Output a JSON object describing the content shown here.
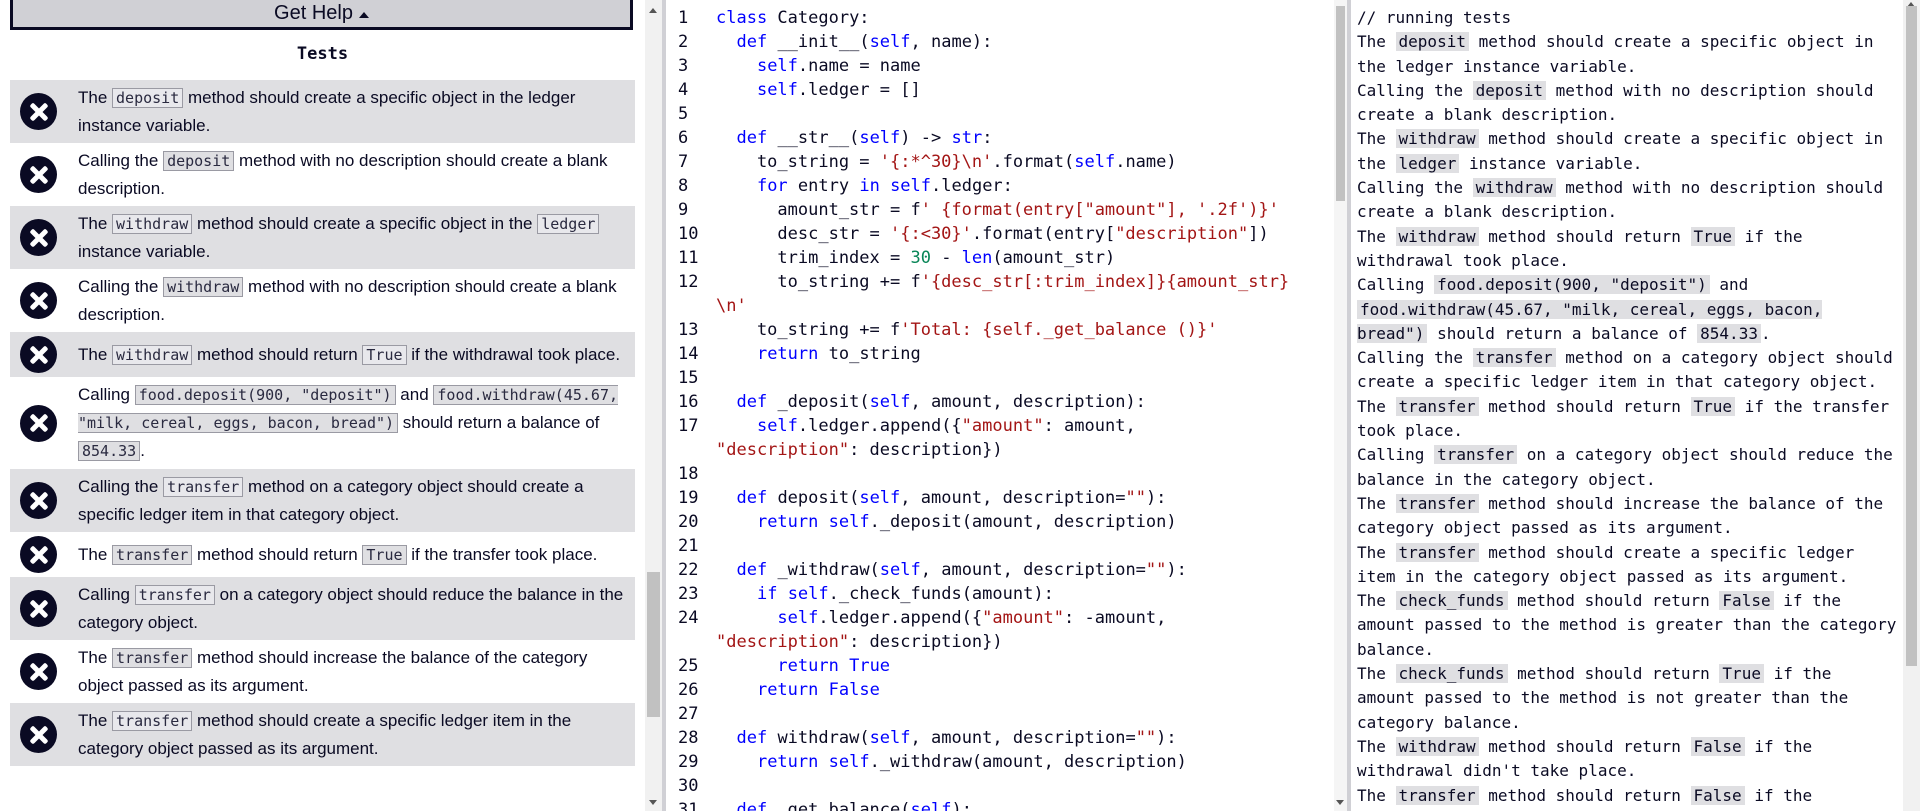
{
  "help_button": {
    "label": "Get Help"
  },
  "tests_heading": "Tests",
  "tests": [
    [
      {
        "t": "The "
      },
      {
        "c": "deposit"
      },
      {
        "t": " method should create a specific object in the ledger instance variable."
      }
    ],
    [
      {
        "t": "Calling the "
      },
      {
        "c": "deposit"
      },
      {
        "t": " method with no description should create a blank description."
      }
    ],
    [
      {
        "t": "The "
      },
      {
        "c": "withdraw"
      },
      {
        "t": " method should create a specific object in the "
      },
      {
        "c": "ledger"
      },
      {
        "t": " instance variable."
      }
    ],
    [
      {
        "t": "Calling the "
      },
      {
        "c": "withdraw"
      },
      {
        "t": " method with no description should create a blank description."
      }
    ],
    [
      {
        "t": "The "
      },
      {
        "c": "withdraw"
      },
      {
        "t": " method should return "
      },
      {
        "c": "True"
      },
      {
        "t": " if the withdrawal took place."
      }
    ],
    [
      {
        "t": "Calling "
      },
      {
        "c": "food.deposit(900, \"deposit\")"
      },
      {
        "t": " and "
      },
      {
        "c": "food.withdraw(45.67, \"milk, cereal, eggs, bacon, bread\")"
      },
      {
        "t": " should return a balance of "
      },
      {
        "c": "854.33"
      },
      {
        "t": "."
      }
    ],
    [
      {
        "t": "Calling the "
      },
      {
        "c": "transfer"
      },
      {
        "t": " method on a category object should create a specific ledger item in that category object."
      }
    ],
    [
      {
        "t": "The "
      },
      {
        "c": "transfer"
      },
      {
        "t": " method should return "
      },
      {
        "c": "True"
      },
      {
        "t": " if the transfer took place."
      }
    ],
    [
      {
        "t": "Calling "
      },
      {
        "c": "transfer"
      },
      {
        "t": " on a category object should reduce the balance in the category object."
      }
    ],
    [
      {
        "t": "The "
      },
      {
        "c": "transfer"
      },
      {
        "t": " method should increase the balance of the category object passed as its argument."
      }
    ],
    [
      {
        "t": "The "
      },
      {
        "c": "transfer"
      },
      {
        "t": " method should create a specific ledger item in the category object passed as its argument."
      }
    ]
  ],
  "code_lines": [
    {
      "n": "1",
      "s": [
        [
          "kw",
          "class"
        ],
        [
          "op",
          " Category:"
        ]
      ]
    },
    {
      "n": "2",
      "s": [
        [
          "op",
          "  "
        ],
        [
          "kw",
          "def"
        ],
        [
          "op",
          " __init__("
        ],
        [
          "slf",
          "self"
        ],
        [
          "op",
          ", name):"
        ]
      ]
    },
    {
      "n": "3",
      "s": [
        [
          "op",
          "    "
        ],
        [
          "slf",
          "self"
        ],
        [
          "op",
          ".name = name"
        ]
      ]
    },
    {
      "n": "4",
      "s": [
        [
          "op",
          "    "
        ],
        [
          "slf",
          "self"
        ],
        [
          "op",
          ".ledger = []"
        ]
      ]
    },
    {
      "n": "5",
      "s": []
    },
    {
      "n": "6",
      "s": [
        [
          "op",
          "  "
        ],
        [
          "kw",
          "def"
        ],
        [
          "op",
          " __str__("
        ],
        [
          "slf",
          "self"
        ],
        [
          "op",
          ") -> "
        ],
        [
          "kw",
          "str"
        ],
        [
          "op",
          ":"
        ]
      ]
    },
    {
      "n": "7",
      "s": [
        [
          "op",
          "    to_string = "
        ],
        [
          "str",
          "'{:*^30}\\n'"
        ],
        [
          "op",
          ".format("
        ],
        [
          "slf",
          "self"
        ],
        [
          "op",
          ".name)"
        ]
      ]
    },
    {
      "n": "8",
      "s": [
        [
          "op",
          "    "
        ],
        [
          "kw",
          "for"
        ],
        [
          "op",
          " entry "
        ],
        [
          "kw",
          "in"
        ],
        [
          "op",
          " "
        ],
        [
          "slf",
          "self"
        ],
        [
          "op",
          ".ledger:"
        ]
      ]
    },
    {
      "n": "9",
      "s": [
        [
          "op",
          "      amount_str = f"
        ],
        [
          "str",
          "' {format(entry[\"amount\"], '.2f')}'"
        ]
      ]
    },
    {
      "n": "10",
      "s": [
        [
          "op",
          "      desc_str = "
        ],
        [
          "str",
          "'{:<30}'"
        ],
        [
          "op",
          ".format(entry["
        ],
        [
          "str",
          "\"description\""
        ],
        [
          "op",
          "])"
        ]
      ]
    },
    {
      "n": "11",
      "s": [
        [
          "op",
          "      trim_index = "
        ],
        [
          "num",
          "30"
        ],
        [
          "op",
          " - "
        ],
        [
          "kw",
          "len"
        ],
        [
          "op",
          "(amount_str)"
        ]
      ]
    },
    {
      "n": "12",
      "s": [
        [
          "op",
          "      to_string += f"
        ],
        [
          "str",
          "'{desc_str[:trim_index]}{amount_str}"
        ]
      ]
    },
    {
      "n": "",
      "s": [
        [
          "str",
          "\\n'"
        ]
      ]
    },
    {
      "n": "13",
      "s": [
        [
          "op",
          "    to_string += f"
        ],
        [
          "str",
          "'Total: {self._get_balance ()}'"
        ]
      ]
    },
    {
      "n": "14",
      "s": [
        [
          "op",
          "    "
        ],
        [
          "kw",
          "return"
        ],
        [
          "op",
          " to_string"
        ]
      ]
    },
    {
      "n": "15",
      "s": []
    },
    {
      "n": "16",
      "s": [
        [
          "op",
          "  "
        ],
        [
          "kw",
          "def"
        ],
        [
          "op",
          " _deposit("
        ],
        [
          "slf",
          "self"
        ],
        [
          "op",
          ", amount, description):"
        ]
      ]
    },
    {
      "n": "17",
      "s": [
        [
          "op",
          "    "
        ],
        [
          "slf",
          "self"
        ],
        [
          "op",
          ".ledger.append({"
        ],
        [
          "str",
          "\"amount\""
        ],
        [
          "op",
          ": amount,"
        ]
      ]
    },
    {
      "n": "",
      "s": [
        [
          "str",
          "\"description\""
        ],
        [
          "op",
          ": description})"
        ]
      ]
    },
    {
      "n": "18",
      "s": []
    },
    {
      "n": "19",
      "s": [
        [
          "op",
          "  "
        ],
        [
          "kw",
          "def"
        ],
        [
          "op",
          " deposit("
        ],
        [
          "slf",
          "self"
        ],
        [
          "op",
          ", amount, description="
        ],
        [
          "str",
          "\"\""
        ],
        [
          "op",
          "):"
        ]
      ]
    },
    {
      "n": "20",
      "s": [
        [
          "op",
          "    "
        ],
        [
          "kw",
          "return"
        ],
        [
          "op",
          " "
        ],
        [
          "slf",
          "self"
        ],
        [
          "op",
          "._deposit(amount, description)"
        ]
      ]
    },
    {
      "n": "21",
      "s": []
    },
    {
      "n": "22",
      "s": [
        [
          "op",
          "  "
        ],
        [
          "kw",
          "def"
        ],
        [
          "op",
          " _withdraw("
        ],
        [
          "slf",
          "self"
        ],
        [
          "op",
          ", amount, description="
        ],
        [
          "str",
          "\"\""
        ],
        [
          "op",
          "):"
        ]
      ]
    },
    {
      "n": "23",
      "s": [
        [
          "op",
          "    "
        ],
        [
          "kw",
          "if"
        ],
        [
          "op",
          " "
        ],
        [
          "slf",
          "self"
        ],
        [
          "op",
          "._check_funds(amount):"
        ]
      ]
    },
    {
      "n": "24",
      "s": [
        [
          "op",
          "      "
        ],
        [
          "slf",
          "self"
        ],
        [
          "op",
          ".ledger.append({"
        ],
        [
          "str",
          "\"amount\""
        ],
        [
          "op",
          ": -amount,"
        ]
      ]
    },
    {
      "n": "",
      "s": [
        [
          "str",
          "\"description\""
        ],
        [
          "op",
          ": description})"
        ]
      ]
    },
    {
      "n": "25",
      "s": [
        [
          "op",
          "      "
        ],
        [
          "kw",
          "return"
        ],
        [
          "op",
          " "
        ],
        [
          "kw",
          "True"
        ]
      ]
    },
    {
      "n": "26",
      "s": [
        [
          "op",
          "    "
        ],
        [
          "kw",
          "return"
        ],
        [
          "op",
          " "
        ],
        [
          "kw",
          "False"
        ]
      ]
    },
    {
      "n": "27",
      "s": []
    },
    {
      "n": "28",
      "s": [
        [
          "op",
          "  "
        ],
        [
          "kw",
          "def"
        ],
        [
          "op",
          " withdraw("
        ],
        [
          "slf",
          "self"
        ],
        [
          "op",
          ", amount, description="
        ],
        [
          "str",
          "\"\""
        ],
        [
          "op",
          "):"
        ]
      ]
    },
    {
      "n": "29",
      "s": [
        [
          "op",
          "    "
        ],
        [
          "kw",
          "return"
        ],
        [
          "op",
          " "
        ],
        [
          "slf",
          "self"
        ],
        [
          "op",
          "._withdraw(amount, description)"
        ]
      ]
    },
    {
      "n": "30",
      "s": []
    },
    {
      "n": "31",
      "s": [
        [
          "op",
          "  "
        ],
        [
          "kw",
          "def"
        ],
        [
          "op",
          " _get_balance("
        ],
        [
          "slf",
          "self"
        ],
        [
          "op",
          "):"
        ]
      ]
    }
  ],
  "console": {
    "header": "// running tests",
    "lines": [
      [
        {
          "t": "The "
        },
        {
          "c": "deposit"
        },
        {
          "t": " method should create a specific object in the ledger instance variable."
        }
      ],
      [
        {
          "t": "Calling the "
        },
        {
          "c": "deposit"
        },
        {
          "t": " method with no description should create a blank description."
        }
      ],
      [
        {
          "t": "The "
        },
        {
          "c": "withdraw"
        },
        {
          "t": " method should create a specific object in the "
        },
        {
          "c": "ledger"
        },
        {
          "t": " instance variable."
        }
      ],
      [
        {
          "t": "Calling the "
        },
        {
          "c": "withdraw"
        },
        {
          "t": " method with no description should create a blank description."
        }
      ],
      [
        {
          "t": "The "
        },
        {
          "c": "withdraw"
        },
        {
          "t": " method should return "
        },
        {
          "c": "True"
        },
        {
          "t": " if the withdrawal took place."
        }
      ],
      [
        {
          "t": "Calling "
        },
        {
          "c": "food.deposit(900, \"deposit\")"
        },
        {
          "t": " and "
        },
        {
          "c": "food.withdraw(45.67, \"milk, cereal, eggs, bacon, bread\")"
        },
        {
          "t": " should return a balance of "
        },
        {
          "c": "854.33"
        },
        {
          "t": "."
        }
      ],
      [
        {
          "t": "Calling the "
        },
        {
          "c": "transfer"
        },
        {
          "t": " method on a category object should create a specific ledger item in that category object."
        }
      ],
      [
        {
          "t": "The "
        },
        {
          "c": "transfer"
        },
        {
          "t": " method should return "
        },
        {
          "c": "True"
        },
        {
          "t": " if the transfer took place."
        }
      ],
      [
        {
          "t": "Calling "
        },
        {
          "c": "transfer"
        },
        {
          "t": " on a category object should reduce the balance in the category object."
        }
      ],
      [
        {
          "t": "The "
        },
        {
          "c": "transfer"
        },
        {
          "t": " method should increase the balance of the category object passed as its argument."
        }
      ],
      [
        {
          "t": "The "
        },
        {
          "c": "transfer"
        },
        {
          "t": " method should create a specific ledger item in the category object passed as its argument."
        }
      ],
      [
        {
          "t": "The "
        },
        {
          "c": "check_funds"
        },
        {
          "t": " method should return "
        },
        {
          "c": "False"
        },
        {
          "t": " if the amount passed to the method is greater than the category balance."
        }
      ],
      [
        {
          "t": "The "
        },
        {
          "c": "check_funds"
        },
        {
          "t": " method should return "
        },
        {
          "c": "True"
        },
        {
          "t": " if the amount passed to the method is not greater than the category balance."
        }
      ],
      [
        {
          "t": "The "
        },
        {
          "c": "withdraw"
        },
        {
          "t": " method should return "
        },
        {
          "c": "False"
        },
        {
          "t": " if the withdrawal didn't take place."
        }
      ],
      [
        {
          "t": "The "
        },
        {
          "c": "transfer"
        },
        {
          "t": " method should return "
        },
        {
          "c": "False"
        },
        {
          "t": " if the transfer didn't take place."
        }
      ]
    ]
  },
  "icons": {
    "fail": "x-circle-icon",
    "caret": "caret-up-icon"
  },
  "colors": {
    "dark": "#0a0a23",
    "shade": "#dfdfe2",
    "keyword": "#0000ff",
    "string": "#a31515",
    "number": "#098658"
  }
}
